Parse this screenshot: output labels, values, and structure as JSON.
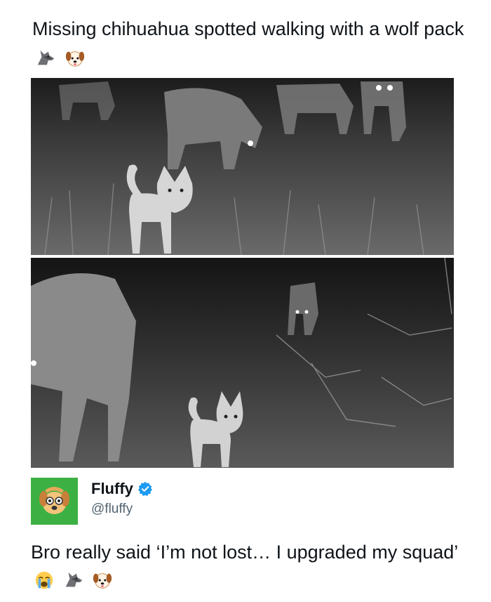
{
  "post": {
    "title_text": "Missing chihuahua spotted walking with a wolf pack",
    "title_emojis": [
      "wolf-emoji",
      "dog-face-emoji"
    ]
  },
  "photos": [
    {
      "description": "night-vision trail camera, chihuahua in front of wolves"
    },
    {
      "description": "night-vision trail camera, chihuahua near a wolf"
    }
  ],
  "reply": {
    "display_name": "Fluffy",
    "handle": "@fluffy",
    "verified": true,
    "text": "Bro really said ‘I’m not lost… I upgraded my squad’",
    "text_emojis": [
      "crying-face-emoji",
      "wolf-emoji",
      "dog-face-emoji"
    ]
  },
  "colors": {
    "avatar_bg": "#3cb043",
    "verified_badge": "#1d9bf0",
    "handle_text": "#536471",
    "text": "#0f1419"
  }
}
